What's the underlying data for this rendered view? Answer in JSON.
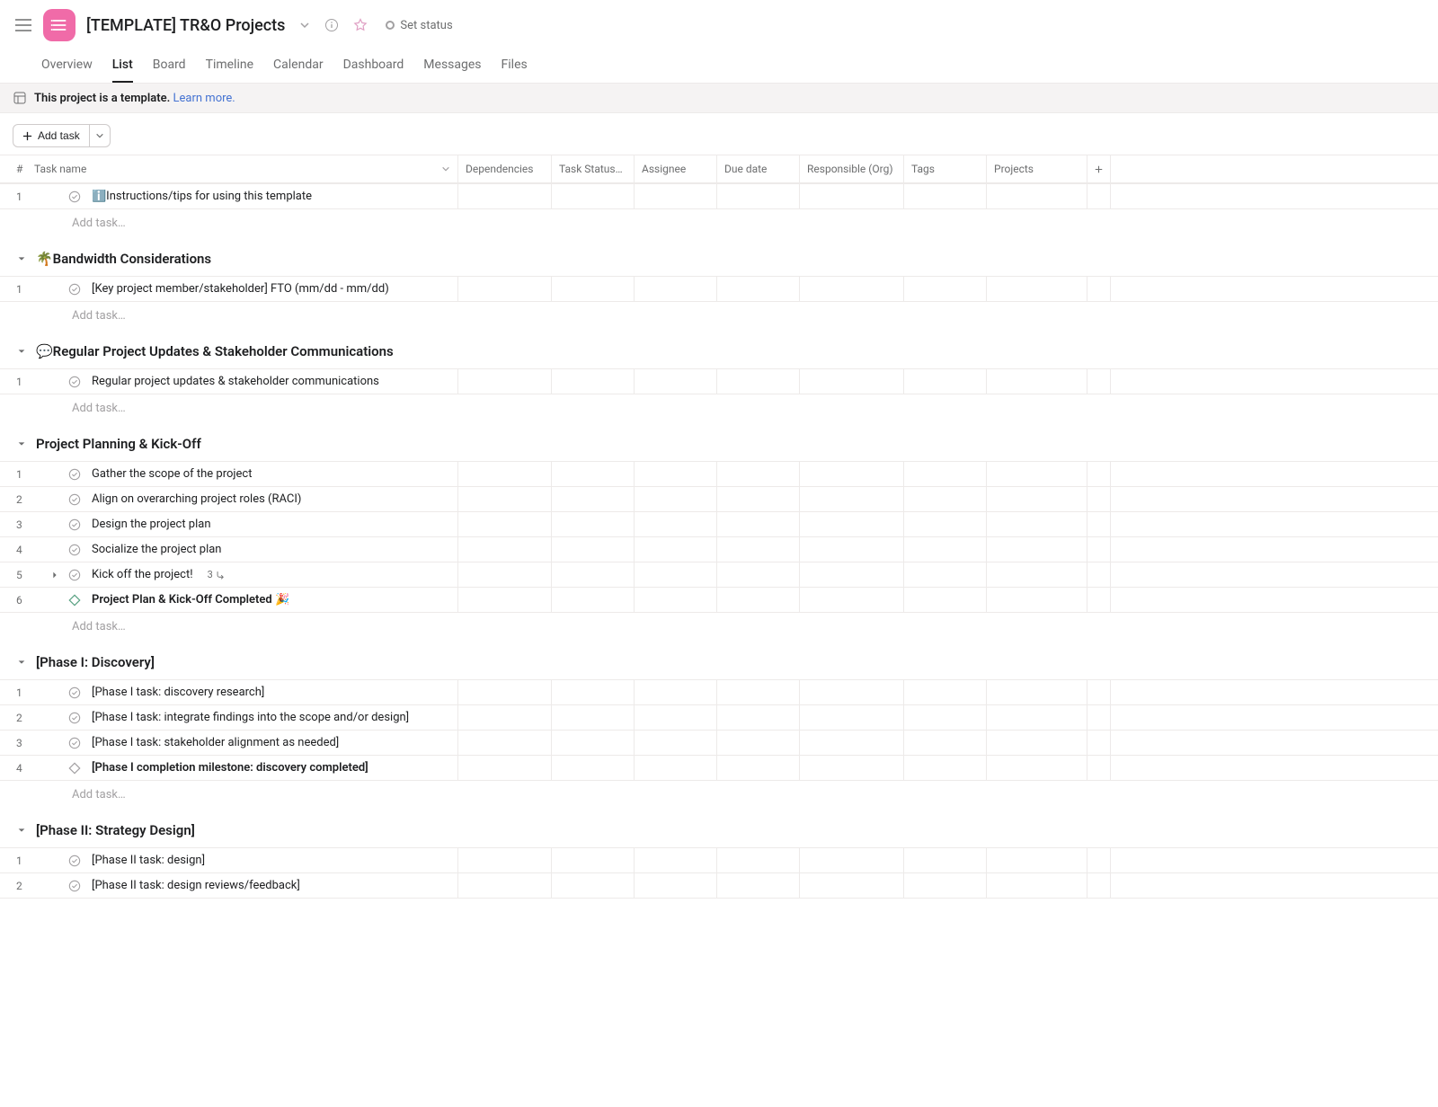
{
  "header": {
    "title": "[TEMPLATE] TR&O Projects",
    "status_label": "Set status"
  },
  "tabs": [
    {
      "label": "Overview",
      "active": false
    },
    {
      "label": "List",
      "active": true
    },
    {
      "label": "Board",
      "active": false
    },
    {
      "label": "Timeline",
      "active": false
    },
    {
      "label": "Calendar",
      "active": false
    },
    {
      "label": "Dashboard",
      "active": false
    },
    {
      "label": "Messages",
      "active": false
    },
    {
      "label": "Files",
      "active": false
    }
  ],
  "banner": {
    "text_strong": "This project is a template.",
    "link": "Learn more."
  },
  "toolbar": {
    "add_task": "Add task"
  },
  "columns": {
    "num": "#",
    "name": "Task name",
    "dependencies": "Dependencies",
    "status": "Task Status…",
    "assignee": "Assignee",
    "due": "Due date",
    "responsible": "Responsible (Org)",
    "tags": "Tags",
    "projects": "Projects"
  },
  "add_task_placeholder": "Add task…",
  "sections": [
    {
      "name": "",
      "tasks": [
        {
          "num": "1",
          "name": "ℹ️Instructions/tips for using this template",
          "milestone": false
        }
      ]
    },
    {
      "name": "🌴Bandwidth Considerations",
      "tasks": [
        {
          "num": "1",
          "name": "[Key project member/stakeholder] FTO (mm/dd - mm/dd)",
          "milestone": false
        }
      ]
    },
    {
      "name": "💬Regular Project Updates & Stakeholder Communications",
      "tasks": [
        {
          "num": "1",
          "name": "Regular project updates & stakeholder communications",
          "milestone": false
        }
      ]
    },
    {
      "name": "Project Planning & Kick-Off",
      "tasks": [
        {
          "num": "1",
          "name": "Gather the scope of the project",
          "milestone": false
        },
        {
          "num": "2",
          "name": "Align on overarching project roles (RACI)",
          "milestone": false
        },
        {
          "num": "3",
          "name": "Design the project plan",
          "milestone": false
        },
        {
          "num": "4",
          "name": "Socialize the project plan",
          "milestone": false
        },
        {
          "num": "5",
          "name": "Kick off the project!",
          "milestone": false,
          "expandable": true,
          "subtasks": "3"
        },
        {
          "num": "6",
          "name": "Project Plan & Kick-Off Completed 🎉",
          "milestone": true,
          "bold": true,
          "green": true
        }
      ]
    },
    {
      "name": "[Phase I: Discovery]",
      "tasks": [
        {
          "num": "1",
          "name": "[Phase I task: discovery research]",
          "milestone": false
        },
        {
          "num": "2",
          "name": "[Phase I task: integrate findings into the scope and/or design]",
          "milestone": false
        },
        {
          "num": "3",
          "name": "[Phase I task: stakeholder alignment as needed]",
          "milestone": false
        },
        {
          "num": "4",
          "name": "[Phase I completion milestone: discovery completed]",
          "milestone": true,
          "bold": true,
          "green": false
        }
      ]
    },
    {
      "name": "[Phase II: Strategy Design]",
      "tasks": [
        {
          "num": "1",
          "name": "[Phase II task: design]",
          "milestone": false
        },
        {
          "num": "2",
          "name": "[Phase II task: design reviews/feedback]",
          "milestone": false
        }
      ],
      "no_add": true
    }
  ]
}
